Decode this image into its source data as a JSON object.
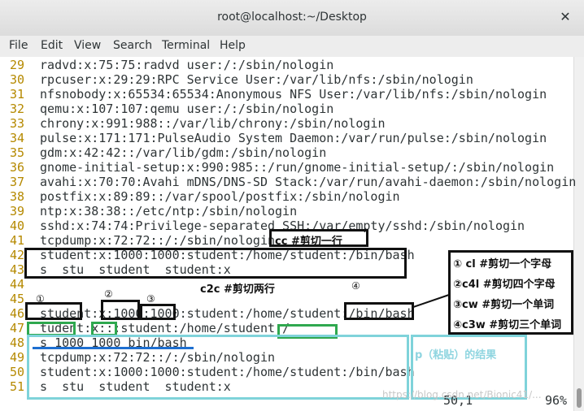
{
  "window": {
    "title": "root@localhost:~/Desktop"
  },
  "menu": [
    "File",
    "Edit",
    "View",
    "Search",
    "Terminal",
    "Help"
  ],
  "lines": [
    {
      "n": "29",
      "t": " radvd:x:75:75:radvd user:/:/sbin/nologin"
    },
    {
      "n": "30",
      "t": " rpcuser:x:29:29:RPC Service User:/var/lib/nfs:/sbin/nologin"
    },
    {
      "n": "31",
      "t": " nfsnobody:x:65534:65534:Anonymous NFS User:/var/lib/nfs:/sbin/nologin"
    },
    {
      "n": "32",
      "t": " qemu:x:107:107:qemu user:/:/sbin/nologin"
    },
    {
      "n": "33",
      "t": " chrony:x:991:988::/var/lib/chrony:/sbin/nologin"
    },
    {
      "n": "34",
      "t": " pulse:x:171:171:PulseAudio System Daemon:/var/run/pulse:/sbin/nologin"
    },
    {
      "n": "35",
      "t": " gdm:x:42:42::/var/lib/gdm:/sbin/nologin"
    },
    {
      "n": "36",
      "t": " gnome-initial-setup:x:990:985::/run/gnome-initial-setup/:/sbin/nologin"
    },
    {
      "n": "37",
      "t": " avahi:x:70:70:Avahi mDNS/DNS-SD Stack:/var/run/avahi-daemon:/sbin/nologin"
    },
    {
      "n": "38",
      "t": " postfix:x:89:89::/var/spool/postfix:/sbin/nologin"
    },
    {
      "n": "39",
      "t": " ntp:x:38:38::/etc/ntp:/sbin/nologin"
    },
    {
      "n": "40",
      "t": " sshd:x:74:74:Privilege-separated SSH:/var/empty/sshd:/sbin/nologin"
    },
    {
      "n": "41",
      "t": " tcpdump:x:72:72::/:/sbin/nologin"
    },
    {
      "n": "42",
      "t": " student:x:1000:1000:student:/home/student:/bin/bash"
    },
    {
      "n": "43",
      "t": " s  stu  student  student:x"
    },
    {
      "n": "44",
      "t": ""
    },
    {
      "n": "45",
      "t": ""
    },
    {
      "n": "46",
      "t": " student:x:1000:1000:student:/home/student:/bin/bash"
    },
    {
      "n": "47",
      "t": " tudent:x:::student:/home/student:/"
    },
    {
      "n": "48",
      "t": " s 1000 1000 bin/bash"
    },
    {
      "n": "49",
      "t": " tcpdump:x:72:72::/:/sbin/nologin"
    },
    {
      "n": "50",
      "t": " student:x:1000:1000:student:/home/student:/bin/bash"
    },
    {
      "n": "51",
      "t": " s  stu  student  student:x"
    }
  ],
  "status": {
    "position": "50,1",
    "percent": "96%"
  },
  "annotations": {
    "cc": "cc  #剪切一行",
    "c2c": "c2c  #剪切两行",
    "paste": "p（粘贴）的结果",
    "circ1": "①",
    "circ2": "②",
    "circ3": "③",
    "circ4": "④",
    "legend": [
      "① cl   #剪切一个字母",
      "②c4l  #剪切四个字母",
      "③cw  #剪切一个单词",
      "④c3w #剪切三个单词"
    ]
  },
  "watermark": "https://blog.csdn.net/Bionic41/..."
}
